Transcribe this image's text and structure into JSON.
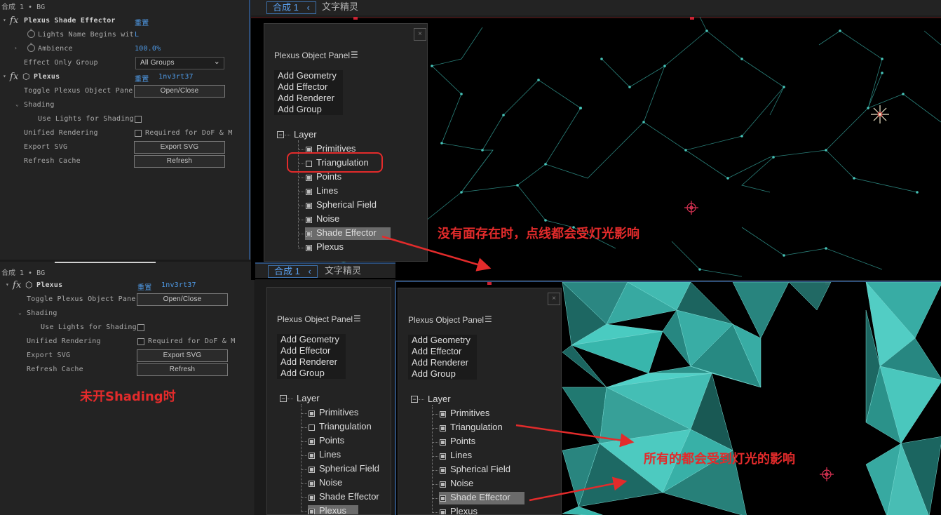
{
  "top_effect_panel": {
    "header": "合成 1 • BG",
    "rows": [
      {
        "kind": "fx",
        "label": "Plexus Shade Effector",
        "value": "重置"
      },
      {
        "kind": "param",
        "label": "Lights Name Begins wit",
        "value": "L"
      },
      {
        "kind": "param",
        "label": "Ambience",
        "value": "100.0%"
      },
      {
        "kind": "dropdown",
        "label": "Effect Only Group",
        "value": "All Groups"
      },
      {
        "kind": "fx",
        "label": "Plexus",
        "value": "重置",
        "value2": "1nv3rt37"
      },
      {
        "kind": "button",
        "label": "Toggle Plexus Object Pane",
        "button": "Open/Close"
      },
      {
        "kind": "group",
        "label": "Shading"
      },
      {
        "kind": "check",
        "label": "Use Lights for Shading"
      },
      {
        "kind": "check2",
        "label": "Unified Rendering",
        "check_label": "Required for DoF & M"
      },
      {
        "kind": "button",
        "label": "Export SVG",
        "button": "Export SVG"
      },
      {
        "kind": "button",
        "label": "Refresh Cache",
        "button": "Refresh"
      }
    ]
  },
  "bottom_effect_panel": {
    "header": "合成 1 • BG",
    "rows": [
      {
        "kind": "fx",
        "label": "Plexus",
        "value": "重置",
        "value2": "1nv3rt37"
      },
      {
        "kind": "button",
        "label": "Toggle Plexus Object Pane",
        "button": "Open/Close"
      },
      {
        "kind": "group",
        "label": "Shading"
      },
      {
        "kind": "check",
        "label": "Use Lights for Shading"
      },
      {
        "kind": "check2",
        "label": "Unified Rendering",
        "check_label": "Required for DoF & M"
      },
      {
        "kind": "button",
        "label": "Export SVG",
        "button": "Export SVG"
      },
      {
        "kind": "button",
        "label": "Refresh Cache",
        "button": "Refresh"
      }
    ]
  },
  "comp_tabs": {
    "active": "合成 1",
    "other": "文字精灵"
  },
  "object_panel": {
    "title": "Plexus Object Panel",
    "add_buttons": [
      "Add Geometry",
      "Add Effector",
      "Add Renderer",
      "Add Group"
    ],
    "root": "Layer",
    "items": [
      "Primitives",
      "Triangulation",
      "Points",
      "Lines",
      "Spherical Field",
      "Noise",
      "Shade Effector",
      "Plexus"
    ]
  },
  "annotations": {
    "note_top": "没有面存在时，点线都会受灯光影响",
    "note_left": "未开Shading时",
    "note_right": "所有的都会受到灯光的影响"
  },
  "colors": {
    "annotation": "#e32b2b",
    "link_blue": "#4f9be8",
    "plexus_teal": "#4fd6cc"
  }
}
